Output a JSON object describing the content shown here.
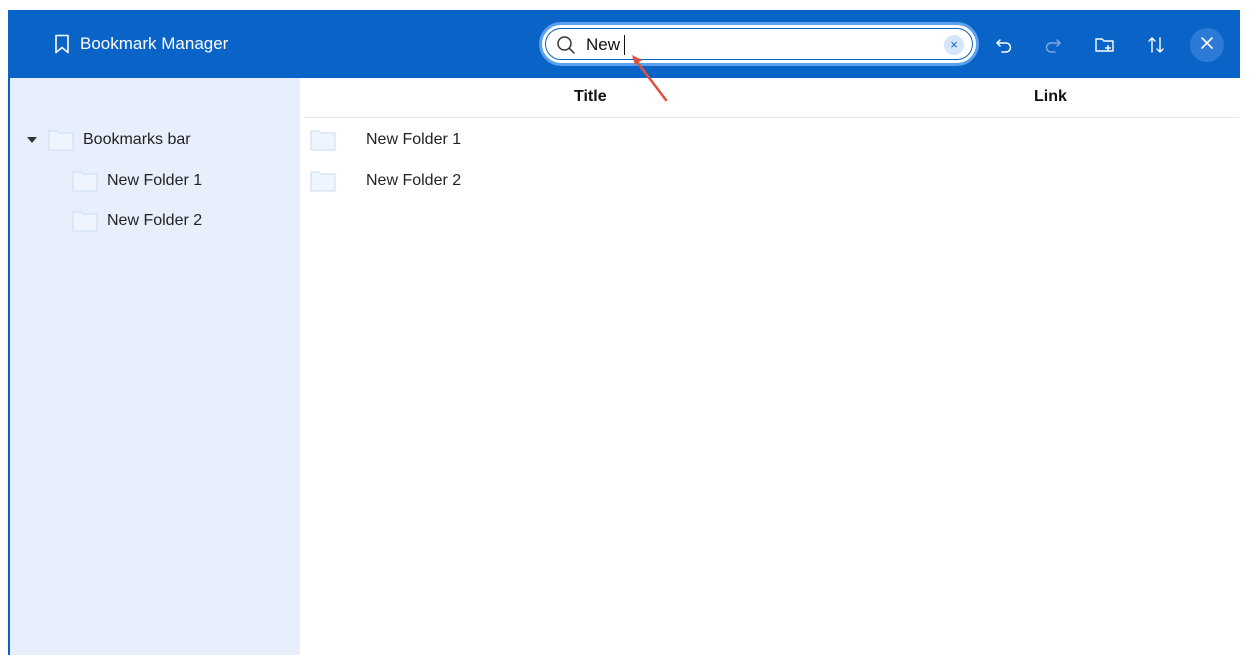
{
  "app": {
    "title": "Bookmark Manager",
    "accent_color": "#0a64c8",
    "sidebar_bg": "#e8effc"
  },
  "search": {
    "value": "New",
    "placeholder": "Search bookmarks",
    "clear_label": "×"
  },
  "toolbar": {
    "undo_icon": "undo-icon",
    "redo_icon": "redo-icon",
    "new_folder_icon": "new-folder-icon",
    "sort_icon": "sort-icon",
    "close_icon": "close-icon"
  },
  "sidebar": {
    "root": {
      "label": "Bookmarks bar",
      "expanded": true
    },
    "children": [
      {
        "label": "New Folder 1"
      },
      {
        "label": "New Folder 2"
      }
    ]
  },
  "main": {
    "columns": [
      "Title",
      "Link"
    ],
    "rows": [
      {
        "title": "New Folder 1",
        "link": ""
      },
      {
        "title": "New Folder 2",
        "link": ""
      }
    ]
  }
}
